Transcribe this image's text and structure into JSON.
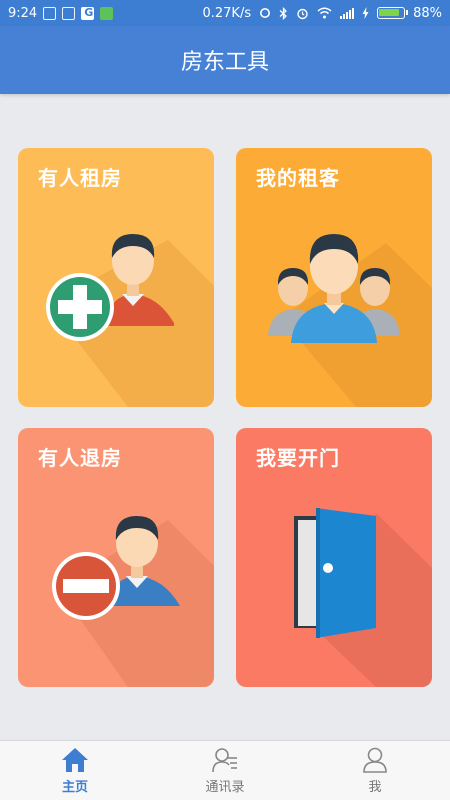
{
  "status_bar": {
    "time": "9:24",
    "speed": "0.27K/s",
    "battery": "88%"
  },
  "header": {
    "title": "房东工具"
  },
  "tiles": [
    {
      "label": "有人租房",
      "color": "#fdbc55"
    },
    {
      "label": "我的租客",
      "color": "#fcac36"
    },
    {
      "label": "有人退房",
      "color": "#fa9472"
    },
    {
      "label": "我要开门",
      "color": "#fa7a64"
    }
  ],
  "bottom_nav": {
    "items": [
      {
        "label": "主页",
        "icon": "home-icon",
        "active": true
      },
      {
        "label": "通讯录",
        "icon": "contacts-icon",
        "active": false
      },
      {
        "label": "我",
        "icon": "profile-icon",
        "active": false
      }
    ],
    "active_color": "#3d7ed3"
  }
}
